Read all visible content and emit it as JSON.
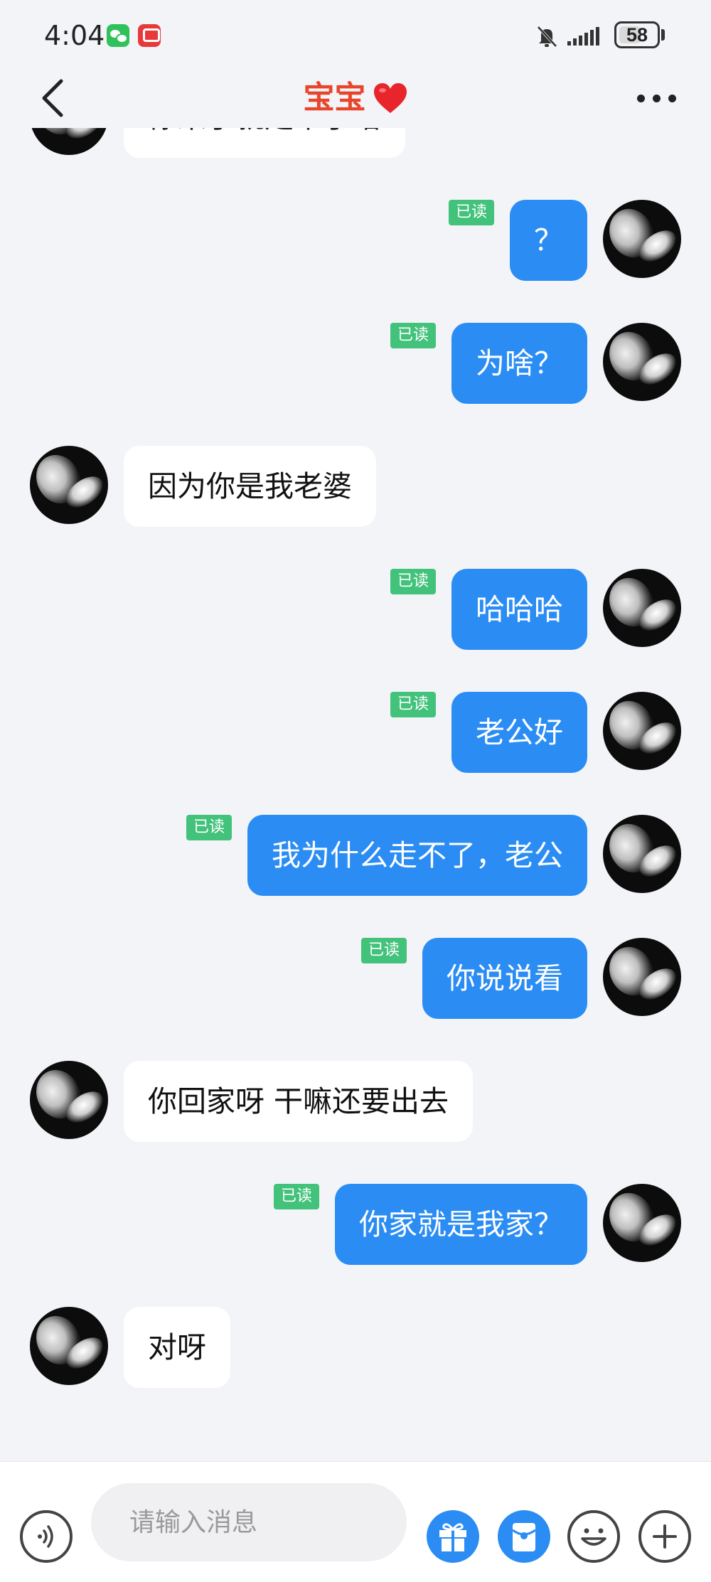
{
  "status_bar": {
    "time": "4:04",
    "battery": "58",
    "battery_level_percent": 58,
    "icons": [
      "wechat-icon",
      "app-notification-icon",
      "mute-icon",
      "signal-icon",
      "battery-icon"
    ]
  },
  "header": {
    "title": "宝宝",
    "title_color": "#e8452b",
    "icons": [
      "back-icon",
      "heart-icon",
      "more-icon"
    ]
  },
  "colors": {
    "outgoing_bubble": "#2b8df3",
    "incoming_bubble": "#ffffff",
    "read_badge": "#42c27a",
    "background": "#f2f4f8"
  },
  "messages": [
    {
      "side": "in",
      "text": "你来了就走不了咯"
    },
    {
      "side": "out",
      "text": "？",
      "status": "已读"
    },
    {
      "side": "out",
      "text": "为啥？",
      "status": "已读"
    },
    {
      "side": "in",
      "text": "因为你是我老婆"
    },
    {
      "side": "out",
      "text": "哈哈哈",
      "status": "已读"
    },
    {
      "side": "out",
      "text": "老公好",
      "status": "已读"
    },
    {
      "side": "out",
      "text": "我为什么走不了，老公",
      "status": "已读"
    },
    {
      "side": "out",
      "text": "你说说看",
      "status": "已读"
    },
    {
      "side": "in",
      "text": "你回家呀 干嘛还要出去"
    },
    {
      "side": "out",
      "text": "你家就是我家？",
      "status": "已读"
    },
    {
      "side": "in",
      "text": "对呀"
    }
  ],
  "input_bar": {
    "placeholder": "请输入消息",
    "icons": [
      "voice-icon",
      "gift-icon",
      "red-packet-icon",
      "emoji-icon",
      "plus-icon"
    ]
  }
}
